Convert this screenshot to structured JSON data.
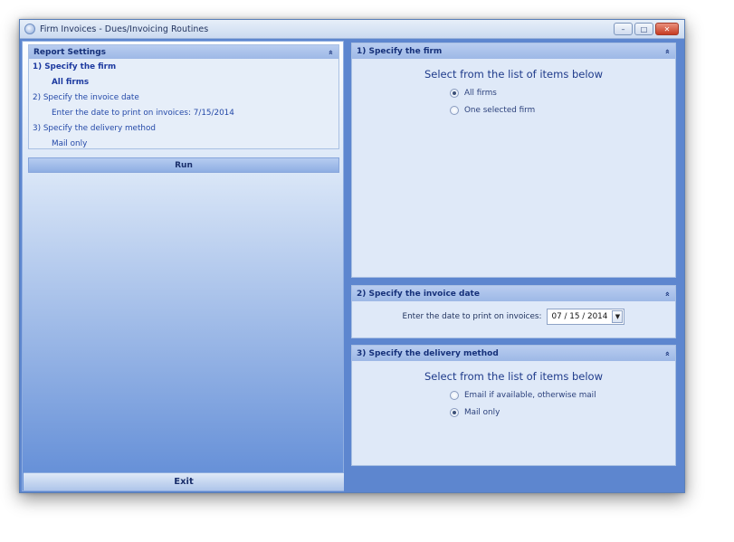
{
  "window": {
    "title": "Firm Invoices - Dues/Invoicing Routines",
    "controls": {
      "minimize": "–",
      "maximize": "□",
      "close": "✕"
    }
  },
  "left": {
    "settings_header": "Report Settings",
    "collapse_icon": "»",
    "lines": [
      {
        "text": "1)  Specify the firm",
        "style": "step-bold"
      },
      {
        "text": "All firms",
        "style": "indent-bold"
      },
      {
        "text": "2)  Specify the invoice date",
        "style": "step"
      },
      {
        "text": "Enter the date to print on invoices:  7/15/2014",
        "style": "indent"
      },
      {
        "text": "3)  Specify the delivery method",
        "style": "step"
      },
      {
        "text": "Mail only",
        "style": "indent"
      }
    ],
    "run_label": "Run",
    "exit_label": "Exit"
  },
  "firm_panel": {
    "header": "1)  Specify the firm",
    "collapse_icon": "»",
    "select_title": "Select from the list of items below",
    "options": [
      {
        "label": "All firms",
        "checked": true
      },
      {
        "label": "One selected firm",
        "checked": false
      }
    ]
  },
  "date_panel": {
    "header": "2)  Specify the invoice date",
    "collapse_icon": "»",
    "label": "Enter the date to print on invoices:",
    "value": "07  /  15  /  2014",
    "dropdown_icon": "▼"
  },
  "delivery_panel": {
    "header": "3)  Specify the delivery method",
    "collapse_icon": "»",
    "select_title": "Select from the list of items below",
    "options": [
      {
        "label": "Email if available, otherwise mail",
        "checked": false
      },
      {
        "label": "Mail only",
        "checked": true
      }
    ]
  },
  "colors": {
    "window_blue": "#5d86cf",
    "header_blue": "#9db8e6",
    "panel_bg": "#dfe9f8",
    "text_blue": "#1e3a8a"
  }
}
